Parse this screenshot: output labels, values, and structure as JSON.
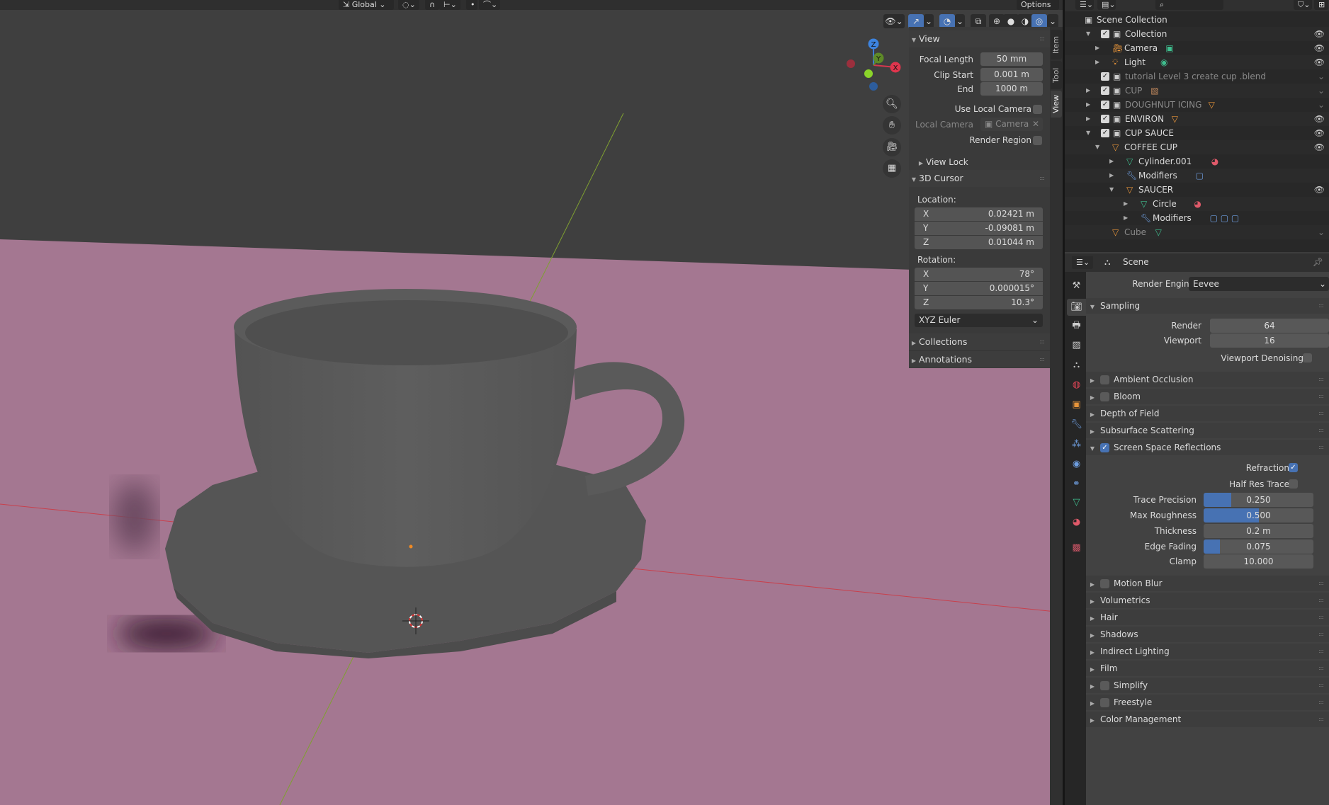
{
  "colors": {
    "accent": "#4772b3",
    "plane": "#a47791",
    "mesh": "#585858",
    "x_axis": "#c8404c",
    "y_axis": "#7fa030"
  },
  "viewport_header": {
    "orientation": "Global",
    "options": "Options"
  },
  "gizmo": {
    "x": "X",
    "y": "Y",
    "z": "Z"
  },
  "npanel": {
    "tabs": [
      {
        "label": "Item",
        "active": false
      },
      {
        "label": "Tool",
        "active": false
      },
      {
        "label": "View",
        "active": true
      }
    ],
    "view": {
      "title": "View",
      "focal_length_label": "Focal Length",
      "focal_length": "50 mm",
      "clip_start_label": "Clip Start",
      "clip_start": "0.001 m",
      "end_label": "End",
      "end": "1000 m",
      "use_local_camera_label": "Use Local Camera",
      "use_local_camera": false,
      "local_camera_label": "Local Camera",
      "local_camera": "Camera",
      "render_region_label": "Render Region",
      "render_region": false,
      "view_lock": "View Lock"
    },
    "cursor": {
      "title": "3D Cursor",
      "location_label": "Location:",
      "loc_x": "0.02421 m",
      "loc_y": "-0.09081 m",
      "loc_z": "0.01044 m",
      "rotation_label": "Rotation:",
      "rot_x": "78°",
      "rot_y": "0.000015°",
      "rot_z": "10.3°",
      "axis_x": "X",
      "axis_y": "Y",
      "axis_z": "Z",
      "mode": "XYZ Euler"
    },
    "collections": "Collections",
    "annotations": "Annotations"
  },
  "outliner": {
    "rows": [
      {
        "label": "Scene Collection",
        "depth": 0,
        "icon": "collection-icon",
        "check": false,
        "expand": "none",
        "eye": false,
        "dim": false
      },
      {
        "label": "Collection",
        "depth": 1,
        "icon": "collection-icon",
        "check": true,
        "expand": "open",
        "eye": true,
        "dim": false
      },
      {
        "label": "Camera",
        "depth": 2,
        "icon": "camera-object-icon",
        "data_icon": "camera-data-icon",
        "expand": "closed",
        "eye": true,
        "dim": false
      },
      {
        "label": "Light",
        "depth": 2,
        "icon": "light-object-icon",
        "data_icon": "light-data-icon",
        "expand": "closed",
        "eye": true,
        "dim": false
      },
      {
        "label": "tutorial Level 3 create cup .blend",
        "depth": 1,
        "icon": "collection-icon",
        "check": true,
        "expand": "none",
        "eye": false,
        "dim": true
      },
      {
        "label": "CUP",
        "depth": 1,
        "icon": "collection-icon",
        "check": true,
        "expand": "closed",
        "data_icon": "image-icon",
        "eye": false,
        "dim": true
      },
      {
        "label": "DOUGHNUT ICING",
        "depth": 1,
        "icon": "collection-icon",
        "check": true,
        "expand": "closed",
        "data_icon": "object-icon",
        "eye": false,
        "dim": true
      },
      {
        "label": "ENVIRON",
        "depth": 1,
        "icon": "collection-icon",
        "check": true,
        "expand": "closed",
        "data_icon": "object-icon",
        "eye": true,
        "dim": false
      },
      {
        "label": "CUP SAUCE",
        "depth": 1,
        "icon": "collection-icon",
        "check": true,
        "expand": "open",
        "eye": true,
        "dim": false
      },
      {
        "label": "COFFEE CUP",
        "depth": 2,
        "icon": "object-icon",
        "expand": "open",
        "eye": true,
        "dim": false
      },
      {
        "label": "Cylinder.001",
        "depth": 3,
        "icon": "mesh-icon",
        "data_icon": "material-icon",
        "expand": "closed",
        "eye": false,
        "dim": false
      },
      {
        "label": "Modifiers",
        "depth": 3,
        "icon": "wrench-icon",
        "data_icon": "modifier-icon",
        "expand": "closed",
        "eye": false,
        "dim": false
      },
      {
        "label": "SAUCER",
        "depth": 3,
        "icon": "object-icon",
        "expand": "open",
        "eye": true,
        "dim": false
      },
      {
        "label": "Circle",
        "depth": 4,
        "icon": "mesh-icon",
        "data_icon": "material-icon",
        "expand": "closed",
        "eye": false,
        "dim": false
      },
      {
        "label": "Modifiers",
        "depth": 4,
        "icon": "wrench-icon",
        "data_icon": "modifier-icon-x3",
        "expand": "closed",
        "eye": false,
        "dim": false
      },
      {
        "label": "Cube",
        "depth": 2,
        "icon": "object-icon",
        "data_icon": "mesh-icon",
        "expand": "none",
        "eye": false,
        "dim": true
      }
    ]
  },
  "properties": {
    "context": "Scene",
    "render_engine_label": "Render Engine",
    "render_engine": "Eevee",
    "rows": [
      {
        "type": "section",
        "label": "Sampling",
        "open": true
      },
      {
        "type": "field",
        "label": "Render",
        "value": "64"
      },
      {
        "type": "field",
        "label": "Viewport",
        "value": "16"
      },
      {
        "type": "check",
        "label": "Viewport Denoising",
        "checked": false
      },
      {
        "type": "section",
        "label": "Ambient Occlusion",
        "open": false,
        "checkbox": false
      },
      {
        "type": "section",
        "label": "Bloom",
        "open": false,
        "checkbox": false
      },
      {
        "type": "section",
        "label": "Depth of Field",
        "open": false
      },
      {
        "type": "section",
        "label": "Subsurface Scattering",
        "open": false
      },
      {
        "type": "section",
        "label": "Screen Space Reflections",
        "open": true,
        "checkbox": true
      },
      {
        "type": "check",
        "label": "Refraction",
        "checked": true
      },
      {
        "type": "check",
        "label": "Half Res Trace",
        "checked": false
      },
      {
        "type": "slider",
        "label": "Trace Precision",
        "value": "0.250",
        "fill": 0.25
      },
      {
        "type": "slider",
        "label": "Max Roughness",
        "value": "0.500",
        "fill": 0.5
      },
      {
        "type": "slider",
        "label": "Thickness",
        "value": "0.2 m",
        "fill": 0
      },
      {
        "type": "slider",
        "label": "Edge Fading",
        "value": "0.075",
        "fill": 0.15
      },
      {
        "type": "slider",
        "label": "Clamp",
        "value": "10.000",
        "fill": 0
      },
      {
        "type": "section",
        "label": "Motion Blur",
        "open": false,
        "checkbox": false
      },
      {
        "type": "section",
        "label": "Volumetrics",
        "open": false
      },
      {
        "type": "section",
        "label": "Hair",
        "open": false
      },
      {
        "type": "section",
        "label": "Shadows",
        "open": false
      },
      {
        "type": "section",
        "label": "Indirect Lighting",
        "open": false
      },
      {
        "type": "section",
        "label": "Film",
        "open": false
      },
      {
        "type": "section",
        "label": "Simplify",
        "open": false,
        "checkbox": false
      },
      {
        "type": "section",
        "label": "Freestyle",
        "open": false,
        "checkbox": false
      },
      {
        "type": "section",
        "label": "Color Management",
        "open": false
      }
    ],
    "tabs": [
      "tool-icon",
      "render-icon",
      "output-icon",
      "view-layer-icon",
      "scene-icon",
      "world-icon",
      "object-icon",
      "modifier-icon",
      "particles-icon",
      "physics-icon",
      "constraints-icon",
      "data-icon",
      "material-icon",
      "texture-icon"
    ]
  }
}
